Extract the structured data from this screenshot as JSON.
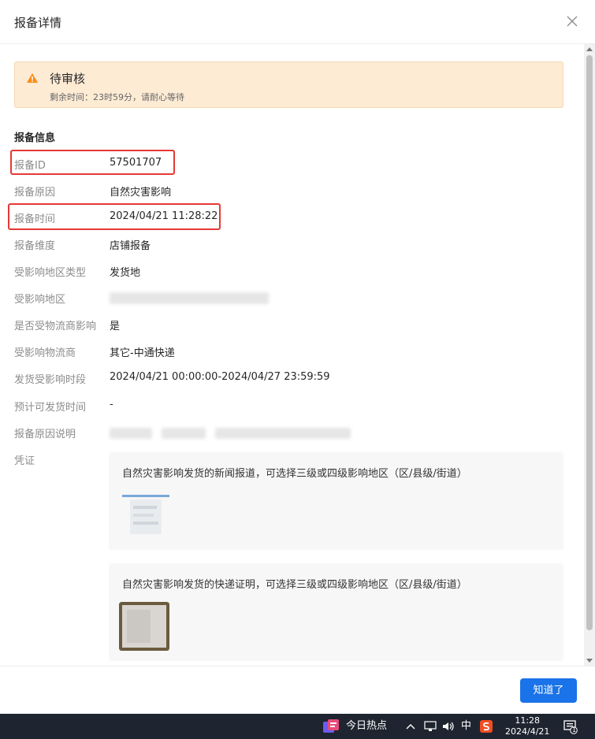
{
  "modal": {
    "title": "报备详情",
    "close_icon": "close-icon"
  },
  "alert": {
    "icon": "warning-triangle-icon",
    "title": "待审核",
    "desc": "剩余时间：23时59分，请耐心等待",
    "color": "#fdebd4",
    "icon_color": "#fa8c16"
  },
  "section": {
    "title": "报备信息"
  },
  "fields": [
    {
      "label": "报备ID",
      "value": "57501707"
    },
    {
      "label": "报备原因",
      "value": "自然灾害影响"
    },
    {
      "label": "报备时间",
      "value": "2024/04/21 11:28:22"
    },
    {
      "label": "报备维度",
      "value": "店铺报备"
    },
    {
      "label": "受影响地区类型",
      "value": "发货地"
    },
    {
      "label": "受影响地区",
      "value": ""
    },
    {
      "label": "是否受物流商影响",
      "value": "是"
    },
    {
      "label": "受影响物流商",
      "value": "其它-中通快递"
    },
    {
      "label": "发货受影响时段",
      "value": "2024/04/21 00:00:00-2024/04/27 23:59:59"
    },
    {
      "label": "预计可发货时间",
      "value": "-"
    },
    {
      "label": "报备原因说明",
      "value": ""
    },
    {
      "label": "凭证",
      "value": ""
    }
  ],
  "evidence": [
    {
      "text": "自然灾害影响发货的新闻报道，可选择三级或四级影响地区（区/县级/街道）"
    },
    {
      "text": "自然灾害影响发货的快递证明，可选择三级或四级影响地区（区/县级/街道）"
    }
  ],
  "footer": {
    "ok_label": "知道了",
    "accent": "#1a73e8"
  },
  "taskbar": {
    "news_label": "今日热点",
    "ime_label": "中",
    "time": "11:28",
    "date": "2024/4/21",
    "notification_count": "1"
  }
}
